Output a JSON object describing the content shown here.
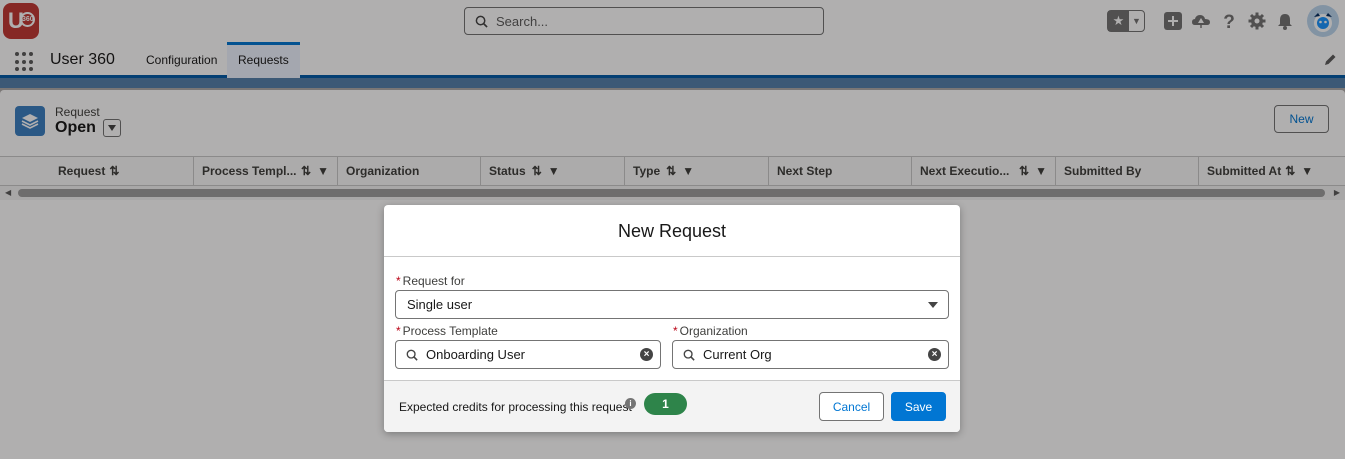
{
  "app": {
    "logo_text": "U",
    "logo_badge": "360",
    "name": "User 360"
  },
  "header": {
    "search_placeholder": "Search...",
    "favorites_icon": "star-icon",
    "icons": [
      "add-icon",
      "trailhead-icon",
      "help-icon",
      "setup-gear-icon",
      "notifications-bell-icon"
    ]
  },
  "nav": {
    "tabs": [
      {
        "label": "Configuration",
        "active": false
      },
      {
        "label": "Requests",
        "active": true
      }
    ]
  },
  "list_view": {
    "object_label": "Request",
    "view_name": "Open",
    "new_button": "New",
    "columns": [
      {
        "label": "Request",
        "sortable": true,
        "filterable": false
      },
      {
        "label": "Process Templ...",
        "sortable": true,
        "filterable": true
      },
      {
        "label": "Organization",
        "sortable": false,
        "filterable": false
      },
      {
        "label": "Status",
        "sortable": true,
        "filterable": true
      },
      {
        "label": "Type",
        "sortable": true,
        "filterable": true
      },
      {
        "label": "Next Step",
        "sortable": false,
        "filterable": false
      },
      {
        "label": "Next Executio...",
        "sortable": true,
        "filterable": true
      },
      {
        "label": "Submitted By",
        "sortable": false,
        "filterable": false
      },
      {
        "label": "Submitted At",
        "sortable": true,
        "filterable": true
      }
    ]
  },
  "modal": {
    "title": "New Request",
    "request_for": {
      "label": "Request for",
      "value": "Single user"
    },
    "process_template": {
      "label": "Process Template",
      "value": "Onboarding User"
    },
    "organization": {
      "label": "Organization",
      "value": "Current Org"
    },
    "credits_text": "Expected credits for processing this request",
    "credits_value": "1",
    "cancel_label": "Cancel",
    "save_label": "Save"
  },
  "colors": {
    "brand_blue": "#0176d3",
    "badge_green": "#2e844a",
    "logo_red": "#c23934"
  }
}
